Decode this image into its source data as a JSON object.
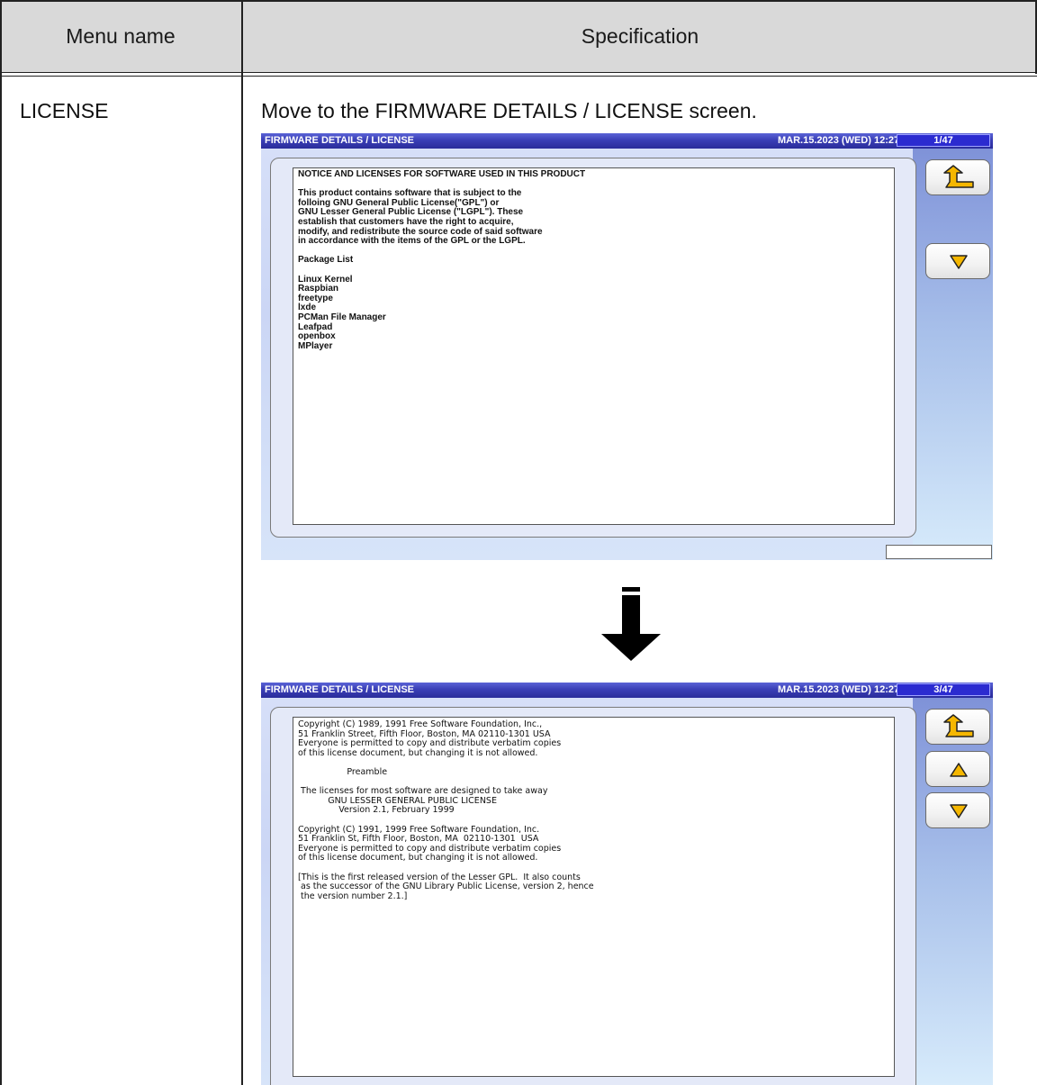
{
  "table": {
    "header": {
      "menu_name": "Menu name",
      "specification": "Specification"
    },
    "row": {
      "menu_name": "LICENSE",
      "specification": "Move to the FIRMWARE DETAILS / LICENSE screen."
    }
  },
  "screen1": {
    "title": "FIRMWARE DETAILS / LICENSE",
    "datetime": "MAR.15.2023 (WED)  12:27",
    "page": "1/47",
    "lines": [
      "NOTICE AND LICENSES FOR SOFTWARE USED IN THIS PRODUCT",
      "",
      "This product contains software that is subject to the",
      "folloing GNU General Public License(\"GPL\") or",
      "GNU Lesser General Public License (\"LGPL\"). These",
      "establish that customers have the right to acquire,",
      "modify, and redistribute the source code of said software",
      "in accordance with the items of the GPL or the LGPL.",
      "",
      "Package List",
      "",
      "Linux Kernel",
      "Raspbian",
      "freetype",
      "lxde",
      "PCMan File Manager",
      "Leafpad",
      "openbox",
      "MPlayer"
    ],
    "buttons": {
      "back_icon": "return-arrow-icon",
      "down_icon": "triangle-down-icon"
    }
  },
  "transition": {
    "icon": "down-arrow-icon"
  },
  "screen2": {
    "title": "FIRMWARE DETAILS / LICENSE",
    "datetime": "MAR.15.2023 (WED)  12:27",
    "page": "3/47",
    "lines": [
      "Copyright (C) 1989, 1991 Free Software Foundation, Inc.,",
      "51 Franklin Street, Fifth Floor, Boston, MA 02110-1301 USA",
      "Everyone is permitted to copy and distribute verbatim copies",
      "of this license document, but changing it is not allowed.",
      "",
      "                  Preamble",
      "",
      " The licenses for most software are designed to take away",
      "           GNU LESSER GENERAL PUBLIC LICENSE",
      "               Version 2.1, February 1999",
      "",
      "Copyright (C) 1991, 1999 Free Software Foundation, Inc.",
      "51 Franklin St, Fifth Floor, Boston, MA  02110-1301  USA",
      "Everyone is permitted to copy and distribute verbatim copies",
      "of this license document, but changing it is not allowed.",
      "",
      "[This is the first released version of the Lesser GPL.  It also counts",
      " as the successor of the GNU Library Public License, version 2, hence",
      " the version number 2.1.]"
    ],
    "buttons": {
      "back_icon": "return-arrow-icon",
      "up_icon": "triangle-up-icon",
      "down_icon": "triangle-down-icon"
    }
  },
  "colors": {
    "header_bg": "#d9d9d9",
    "titlebar": "#3a3fb6",
    "button_icon": "#f5b700"
  }
}
